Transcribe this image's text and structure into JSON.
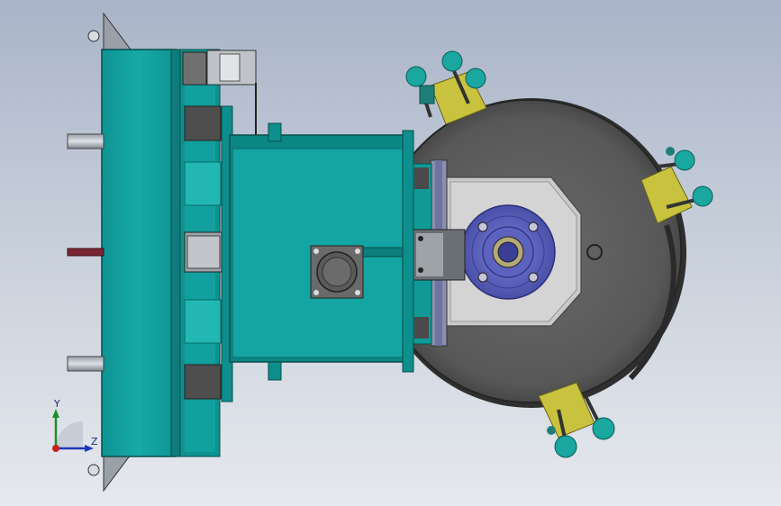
{
  "viewport": {
    "background_top": "#a9b4c8",
    "background_bottom": "#e6e9ee"
  },
  "colors": {
    "teal": "#13a3a1",
    "teal_dark": "#0a6d6b",
    "teal_light": "#3cc4bd",
    "disc": "#5e5e5e",
    "disc_dark": "#3e3e3e",
    "plate": "#c7c7c7",
    "hub": "#5a5fb8",
    "clamp_yellow": "#c9c23e",
    "knob_teal": "#1aa79f"
  },
  "triad": {
    "y_label": "Y",
    "z_label": "Z"
  }
}
